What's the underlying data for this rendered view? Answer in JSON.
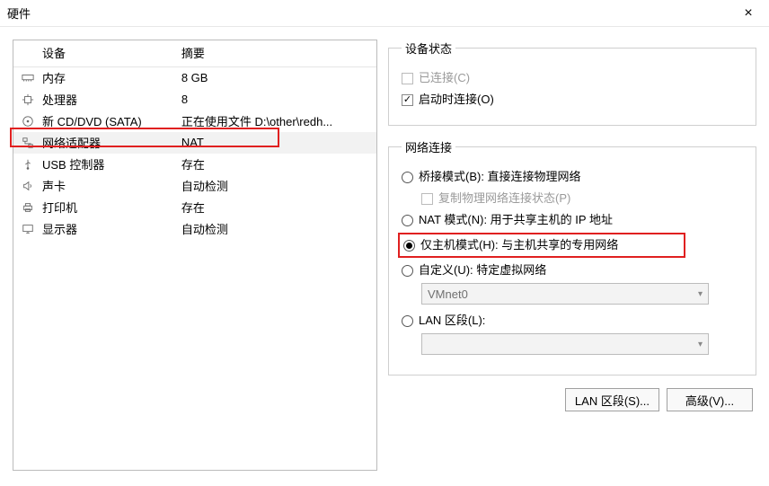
{
  "titlebar": {
    "title": "硬件",
    "close": "×"
  },
  "table": {
    "headers": {
      "device": "设备",
      "summary": "摘要"
    },
    "rows": [
      {
        "icon": "memory-icon",
        "name": "内存",
        "summary": "8 GB"
      },
      {
        "icon": "cpu-icon",
        "name": "处理器",
        "summary": "8"
      },
      {
        "icon": "cd-icon",
        "name": "新 CD/DVD (SATA)",
        "summary": "正在使用文件 D:\\other\\redh..."
      },
      {
        "icon": "network-icon",
        "name": "网络适配器",
        "summary": "NAT",
        "selected": true
      },
      {
        "icon": "usb-icon",
        "name": "USB 控制器",
        "summary": "存在"
      },
      {
        "icon": "sound-icon",
        "name": "声卡",
        "summary": "自动检测"
      },
      {
        "icon": "printer-icon",
        "name": "打印机",
        "summary": "存在"
      },
      {
        "icon": "display-icon",
        "name": "显示器",
        "summary": "自动检测"
      }
    ]
  },
  "status": {
    "legend": "设备状态",
    "connected": "已连接(C)",
    "connected_checked": false,
    "connected_enabled": false,
    "on_power": "启动时连接(O)",
    "on_power_checked": true
  },
  "netconn": {
    "legend": "网络连接",
    "bridged": "桥接模式(B): 直接连接物理网络",
    "replicate": "复制物理网络连接状态(P)",
    "nat": "NAT 模式(N): 用于共享主机的 IP 地址",
    "hostonly": "仅主机模式(H): 与主机共享的专用网络",
    "custom": "自定义(U): 特定虚拟网络",
    "custom_value": "VMnet0",
    "lan": "LAN 区段(L):",
    "lan_value": "",
    "selected": "hostonly"
  },
  "buttons": {
    "lanseg": "LAN 区段(S)...",
    "advanced": "高级(V)..."
  }
}
